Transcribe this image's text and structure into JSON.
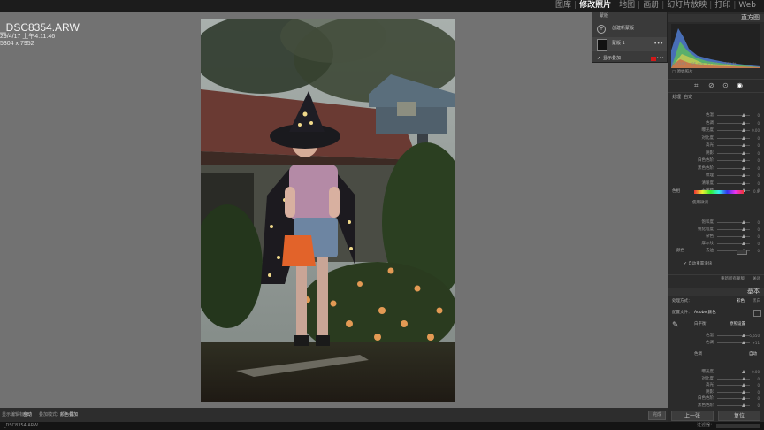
{
  "modules": [
    "图库",
    "修改照片",
    "地图",
    "画册",
    "幻灯片放映",
    "打印",
    "Web"
  ],
  "active_module": "修改照片",
  "photo_info": {
    "filename": "_DSC8354.ARW",
    "datetime": "29/4/17 上午4:11:46",
    "dimensions": "5304 x 7952"
  },
  "popup": {
    "title": "蒙版",
    "create_new": "创建新蒙版",
    "mask_item": "蒙版 1",
    "show_overlay": "显示叠加"
  },
  "panels": {
    "histogram": "直方图",
    "histogram_readout": [
      "ISO 200",
      "85 mm",
      "f / 2.0",
      "1/160 秒"
    ],
    "original_photo": "原始照片",
    "profile_label": "处理",
    "profile_value": "自定",
    "sliders_1": [
      {
        "label": "色温",
        "value": "0"
      },
      {
        "label": "色调",
        "value": "0"
      },
      {
        "label": "曝光度",
        "value": "0.00"
      },
      {
        "label": "对比度",
        "value": "0"
      },
      {
        "label": "高光",
        "value": "0"
      },
      {
        "label": "阴影",
        "value": "0"
      },
      {
        "label": "白色色阶",
        "value": "0"
      },
      {
        "label": "黑色色阶",
        "value": "0"
      },
      {
        "label": "纹理",
        "value": "0"
      },
      {
        "label": "清晰度",
        "value": "0"
      },
      {
        "label": "去朦胧",
        "value": "0"
      }
    ],
    "hue_label": "色相",
    "hue_value": "0.0",
    "use_fine": "使用微调",
    "sliders_2": [
      {
        "label": "饱和度",
        "value": "0"
      },
      {
        "label": "锐化程度",
        "value": "0"
      },
      {
        "label": "杂色",
        "value": "0"
      },
      {
        "label": "摩尔纹",
        "value": "0"
      },
      {
        "label": "去边",
        "value": "0"
      }
    ],
    "color_label": "颜色",
    "auto_reset": "自动重置滑块",
    "reset_all": "重新所有蒙版",
    "close": "关闭",
    "basic": "基本",
    "treatment_label": "处理方式：",
    "treatment_color": "彩色",
    "treatment_bw": "黑白",
    "profile_field": "配置文件：",
    "profile_name": "Adobe 颜色",
    "wb_label": "白平衡：",
    "wb_value": "原照设置",
    "sliders_3": [
      {
        "label": "色温",
        "value": "5,650"
      },
      {
        "label": "色调",
        "value": "+11"
      }
    ],
    "tone_label": "色调",
    "tone_auto": "自动",
    "sliders_4": [
      {
        "label": "曝光度",
        "value": "0.00"
      },
      {
        "label": "对比度",
        "value": "0"
      },
      {
        "label": "高光",
        "value": "0"
      },
      {
        "label": "阴影",
        "value": "0"
      },
      {
        "label": "白色色阶",
        "value": "0"
      },
      {
        "label": "黑色色阶",
        "value": "0"
      }
    ],
    "prev_button": "上一张",
    "reset_button": "复位"
  },
  "bottom": {
    "overlay_label": "显示编辑标记：",
    "overlay_value": "自动",
    "overlay_mode_label": "叠加模式：",
    "overlay_mode_value": "颜色叠加",
    "done": "完成"
  },
  "filmstrip": {
    "left": "_DSC8354.ARW",
    "filter": "过滤器："
  },
  "colors": {
    "accent": "#f0f0f0",
    "panel": "#2b2b2b",
    "canvas": "#727272"
  }
}
